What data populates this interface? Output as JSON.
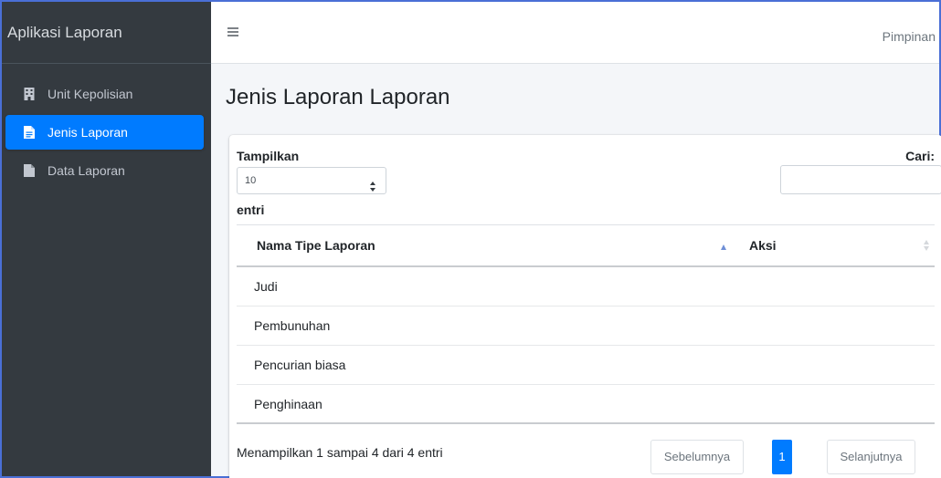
{
  "app": {
    "brand": "Aplikasi Laporan",
    "user": "Pimpinan"
  },
  "sidebar": {
    "items": [
      {
        "label": "Unit Kepolisian",
        "icon": "building-icon",
        "active": false
      },
      {
        "label": "Jenis Laporan",
        "icon": "file-text-icon",
        "active": true
      },
      {
        "label": "Data Laporan",
        "icon": "file-icon",
        "active": false
      }
    ]
  },
  "page": {
    "title": "Jenis Laporan Laporan"
  },
  "table_controls": {
    "show_label": "Tampilkan",
    "page_size": "10",
    "entries_label": "entri",
    "search_label": "Cari:",
    "search_value": ""
  },
  "table": {
    "columns": [
      "Nama Tipe Laporan",
      "Aksi"
    ],
    "rows": [
      {
        "nama": "Judi",
        "aksi": ""
      },
      {
        "nama": "Pembunuhan",
        "aksi": ""
      },
      {
        "nama": "Pencurian biasa",
        "aksi": ""
      },
      {
        "nama": "Penghinaan",
        "aksi": ""
      }
    ]
  },
  "footer": {
    "info": "Menampilkan 1 sampai 4 dari 4 entri",
    "prev": "Sebelumnya",
    "page": "1",
    "next": "Selanjutnya"
  },
  "colors": {
    "sidebar_bg": "#343a40",
    "accent": "#007bff",
    "page_bg": "#f4f6f9"
  }
}
